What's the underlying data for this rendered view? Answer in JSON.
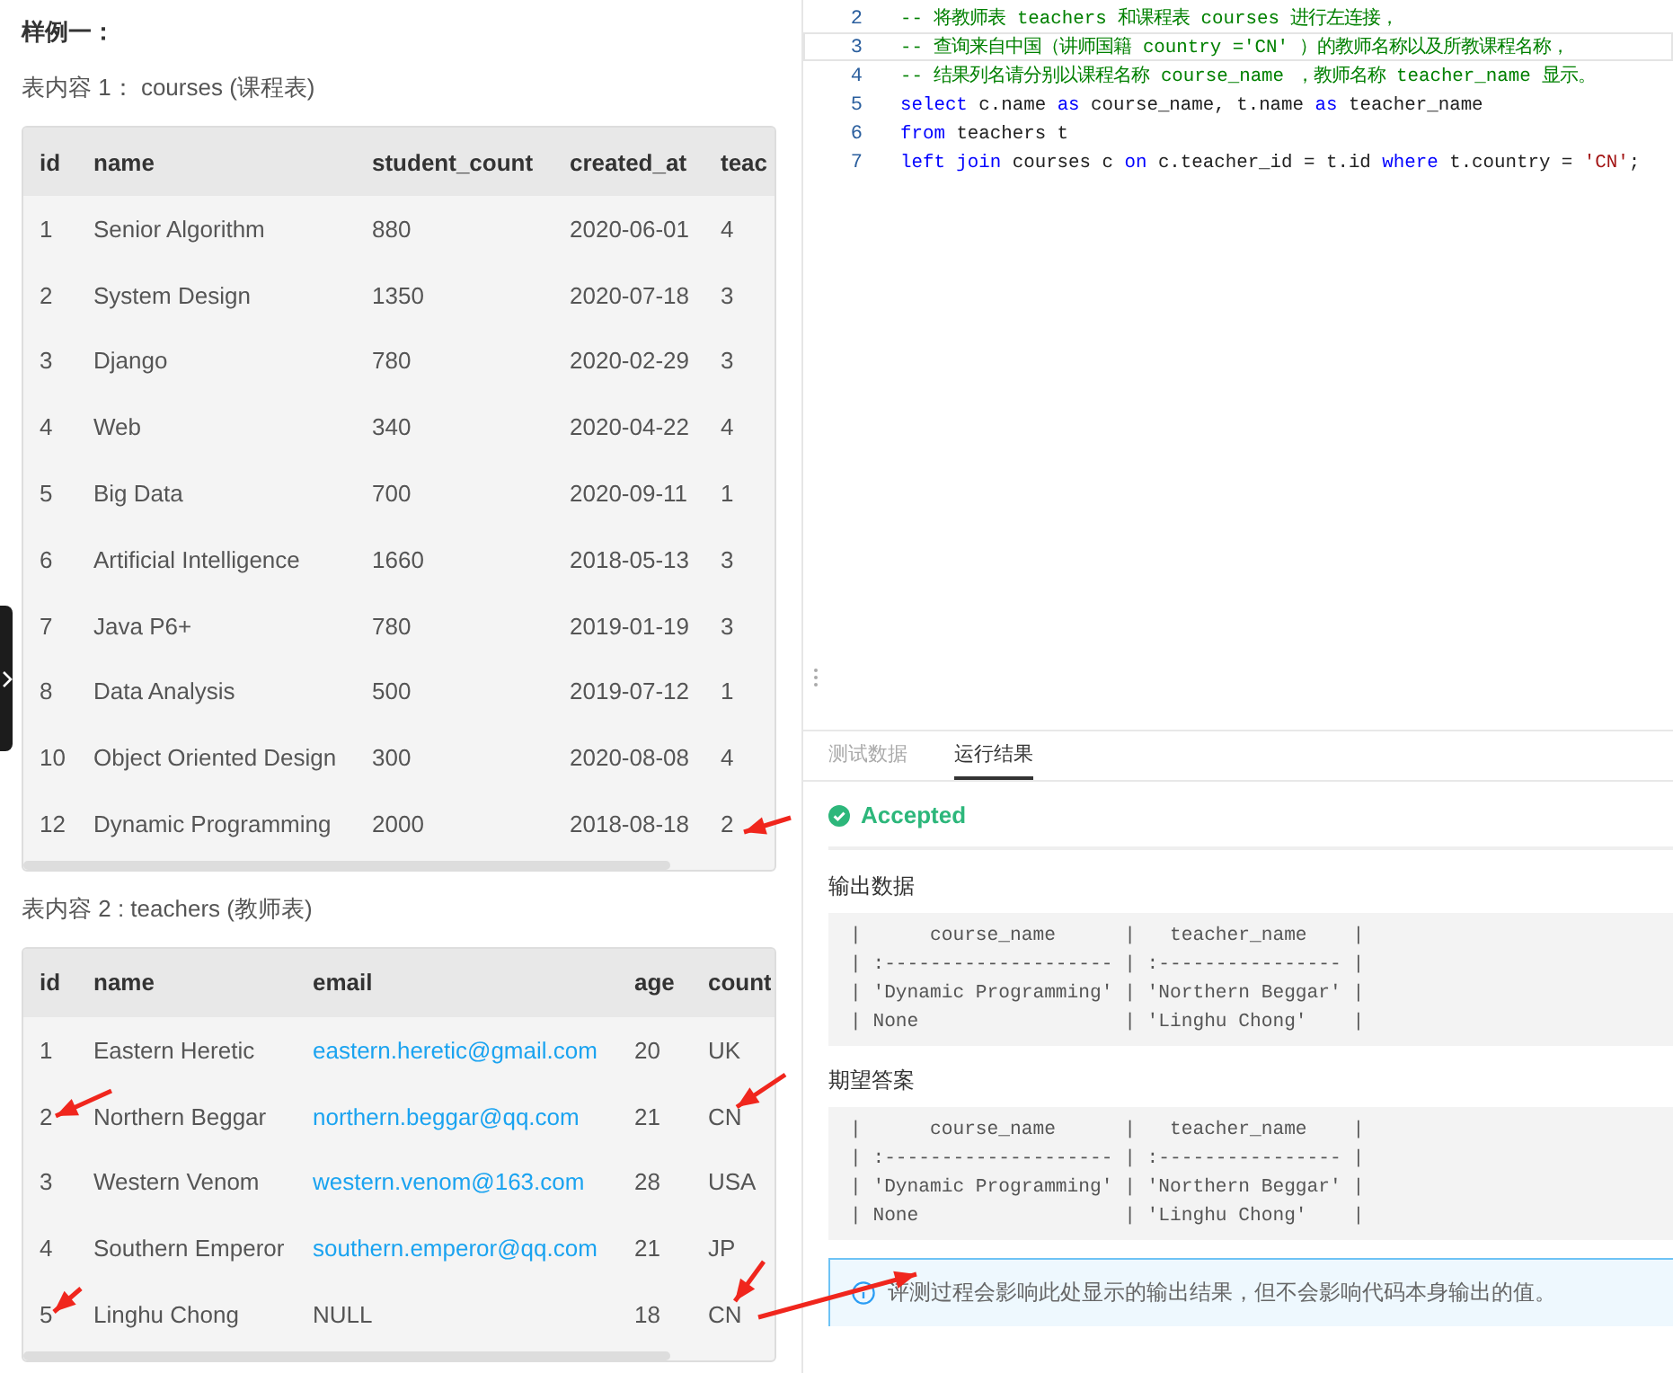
{
  "example_title": "样例一：",
  "tables": [
    {
      "caption": "表内容 1： courses (课程表)",
      "columns": [
        "id",
        "name",
        "student_count",
        "created_at",
        "teac"
      ],
      "rows": [
        [
          "1",
          "Senior Algorithm",
          "880",
          "2020-06-01",
          "4"
        ],
        [
          "2",
          "System Design",
          "1350",
          "2020-07-18",
          "3"
        ],
        [
          "3",
          "Django",
          "780",
          "2020-02-29",
          "3"
        ],
        [
          "4",
          "Web",
          "340",
          "2020-04-22",
          "4"
        ],
        [
          "5",
          "Big Data",
          "700",
          "2020-09-11",
          "1"
        ],
        [
          "6",
          "Artificial Intelligence",
          "1660",
          "2018-05-13",
          "3"
        ],
        [
          "7",
          "Java P6+",
          "780",
          "2019-01-19",
          "3"
        ],
        [
          "8",
          "Data Analysis",
          "500",
          "2019-07-12",
          "1"
        ],
        [
          "10",
          "Object Oriented Design",
          "300",
          "2020-08-08",
          "4"
        ],
        [
          "12",
          "Dynamic Programming",
          "2000",
          "2018-08-18",
          "2"
        ]
      ]
    },
    {
      "caption": "表内容 2 : teachers (教师表)",
      "columns": [
        "id",
        "name",
        "email",
        "age",
        "count"
      ],
      "rows": [
        [
          "1",
          "Eastern Heretic",
          {
            "text": "eastern.heretic@gmail.com",
            "link": true
          },
          "20",
          "UK"
        ],
        [
          "2",
          "Northern Beggar",
          {
            "text": "northern.beggar@qq.com",
            "link": true
          },
          "21",
          "CN"
        ],
        [
          "3",
          "Western Venom",
          {
            "text": "western.venom@163.com",
            "link": true
          },
          "28",
          "USA"
        ],
        [
          "4",
          "Southern Emperor",
          {
            "text": "southern.emperor@qq.com",
            "link": true
          },
          "21",
          "JP"
        ],
        [
          "5",
          "Linghu Chong",
          {
            "text": "NULL",
            "link": false
          },
          "18",
          "CN"
        ]
      ]
    }
  ],
  "code_lines": [
    {
      "number": "2",
      "highlighted": false,
      "tokens": [
        {
          "kind": "comment",
          "text": "-- 将教师表 teachers 和课程表 courses 进行左连接，"
        }
      ]
    },
    {
      "number": "3",
      "highlighted": true,
      "tokens": [
        {
          "kind": "comment",
          "text": "-- 查询来自中国（讲师国籍 country ='CN' ）的教师名称以及所教课程名称，"
        }
      ]
    },
    {
      "number": "4",
      "highlighted": false,
      "tokens": [
        {
          "kind": "comment",
          "text": "-- 结果列名请分别以课程名称 course_name ，教师名称 teacher_name 显示。"
        }
      ]
    },
    {
      "number": "5",
      "highlighted": false,
      "tokens": [
        {
          "kind": "keyword",
          "text": "select"
        },
        {
          "kind": "plain",
          "text": " c.name "
        },
        {
          "kind": "keyword",
          "text": "as"
        },
        {
          "kind": "plain",
          "text": " course_name, t.name "
        },
        {
          "kind": "keyword",
          "text": "as"
        },
        {
          "kind": "plain",
          "text": " teacher_name"
        }
      ]
    },
    {
      "number": "6",
      "highlighted": false,
      "tokens": [
        {
          "kind": "keyword",
          "text": "from"
        },
        {
          "kind": "plain",
          "text": " teachers t"
        }
      ]
    },
    {
      "number": "7",
      "highlighted": false,
      "tokens": [
        {
          "kind": "keyword",
          "text": "left join"
        },
        {
          "kind": "plain",
          "text": " courses c "
        },
        {
          "kind": "keyword",
          "text": "on"
        },
        {
          "kind": "plain",
          "text": " c.teacher_id = t.id "
        },
        {
          "kind": "keyword",
          "text": "where"
        },
        {
          "kind": "plain",
          "text": " t.country = "
        },
        {
          "kind": "string",
          "text": "'CN'"
        },
        {
          "kind": "plain",
          "text": ";"
        }
      ]
    }
  ],
  "result_tabs": [
    {
      "label": "测试数据",
      "selected": false
    },
    {
      "label": "运行结果",
      "selected": true
    }
  ],
  "status": {
    "kind": "accepted",
    "text": "Accepted"
  },
  "outputs": [
    {
      "label": "输出数据",
      "lines": [
        "|      course_name      |   teacher_name    |",
        "| :-------------------- | :---------------- |",
        "| 'Dynamic Programming' | 'Northern Beggar' |",
        "| None                  | 'Linghu Chong'    |"
      ]
    },
    {
      "label": "期望答案",
      "lines": [
        "|      course_name      |   teacher_name    |",
        "| :-------------------- | :---------------- |",
        "| 'Dynamic Programming' | 'Northern Beggar' |",
        "| None                  | 'Linghu Chong'    |"
      ]
    }
  ],
  "notice": "评测过程会影响此处显示的输出结果，但不会影响代码本身输出的值。"
}
